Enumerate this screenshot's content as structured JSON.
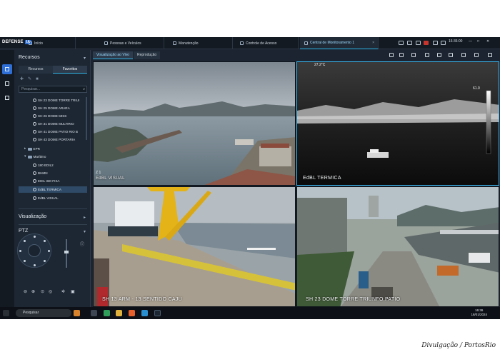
{
  "topbar": {
    "brand": "DEFENSE",
    "brand_badge": "IA",
    "tabs": [
      {
        "label": "Início"
      },
      {
        "label": "Pessoas e Veículos"
      },
      {
        "label": "Manutenção"
      },
      {
        "label": "Controle de Acesso"
      },
      {
        "label": "Central de Monitoramento 1"
      }
    ],
    "time": "16:36:00"
  },
  "panel": {
    "title": "Recursos",
    "subtabs": [
      "Recursos",
      "Favoritos"
    ],
    "search_placeholder": "Pesquisar...",
    "tree": [
      {
        "label": "SH 23 DOME TORRE TRIUI",
        "type": "cam"
      },
      {
        "label": "SH 25 DOME ARARA",
        "type": "cam"
      },
      {
        "label": "SH 26 DOME MISS",
        "type": "cam"
      },
      {
        "label": "SH 31 DOME MULTIRIO",
        "type": "cam"
      },
      {
        "label": "SH 41 DOME PATIO RIO B",
        "type": "cam"
      },
      {
        "label": "SH 43 DOME PORTARIA",
        "type": "cam"
      },
      {
        "label": "EPR",
        "type": "folder"
      },
      {
        "label": "Marítimo",
        "type": "folder-open"
      },
      {
        "label": "180 EDIL2",
        "type": "cam"
      },
      {
        "label": "BHMN",
        "type": "cam"
      },
      {
        "label": "EDIL 330 FIXA",
        "type": "cam"
      },
      {
        "label": "EdBL TERMICA",
        "type": "cam",
        "selected": true
      },
      {
        "label": "EdBL VISUAL",
        "type": "cam"
      }
    ],
    "section_visualizacao": "Visualização",
    "section_ptz": "PTZ"
  },
  "main": {
    "view_tabs": [
      "Visualização ao Vivo",
      "Reprodução"
    ],
    "cameras": [
      {
        "label": "EdBL VISUAL",
        "tag": "Z 1"
      },
      {
        "label": "EdBL TERMICA",
        "tag": "27.2°C",
        "scale_max": "61.0"
      },
      {
        "label": "SH 13 ARM - 13 SENTIDO CAJU"
      },
      {
        "label": "SH 23 DOME TORRE TRIUNFO PATIO"
      }
    ]
  },
  "taskbar": {
    "search_placeholder": "Pesquisar",
    "time": "16:36",
    "date": "18/01/2024"
  },
  "credit": "Divulgação / PortosRio",
  "colors": {
    "accent": "#32b6e8",
    "brand": "#2d6fd6",
    "selection": "#2f4a66"
  }
}
